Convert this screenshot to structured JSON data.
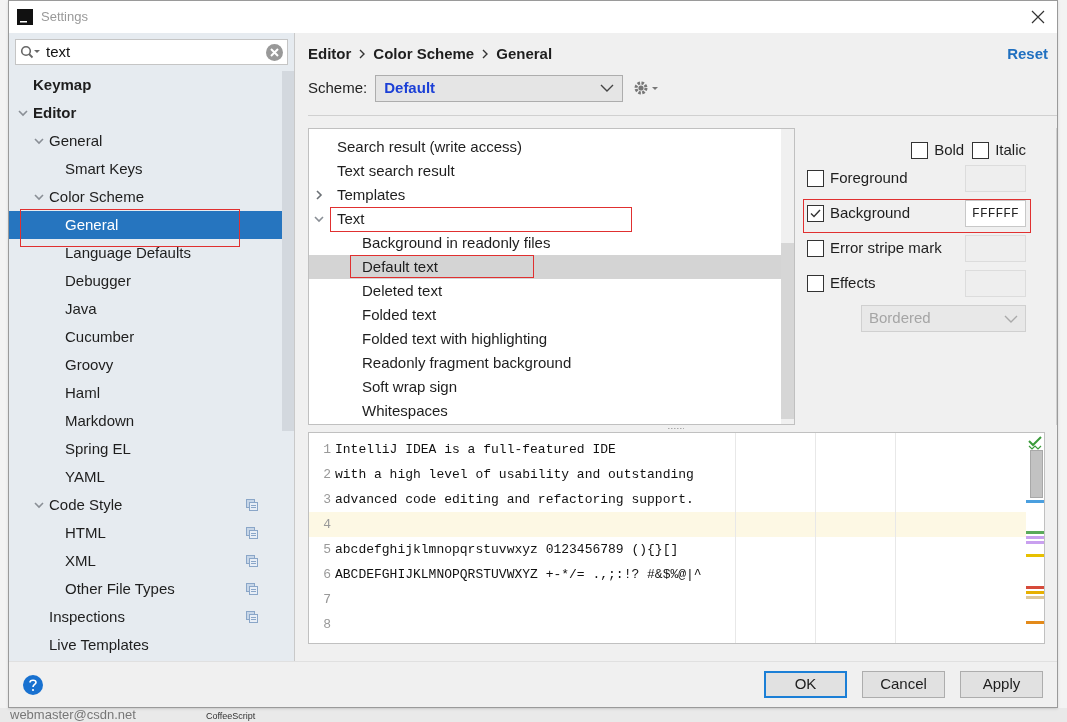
{
  "window": {
    "title": "Settings"
  },
  "background": {
    "texts": [
      "webmaster@csdn.net",
      "CoffeeScript"
    ]
  },
  "search": {
    "value": "text"
  },
  "sidebar": {
    "items": [
      {
        "label": "Keymap"
      },
      {
        "label": "Editor",
        "expanded": true,
        "children": [
          {
            "label": "General",
            "expanded": true,
            "children": [
              {
                "label": "Smart Keys",
                "selected": false
              }
            ]
          },
          {
            "label": "Color Scheme",
            "expanded": true,
            "children": [
              {
                "label": "General",
                "selected": true
              },
              {
                "label": "Language Defaults",
                "selected": false
              },
              {
                "label": "Debugger",
                "selected": false
              },
              {
                "label": "Java",
                "selected": false
              },
              {
                "label": "Cucumber",
                "selected": false
              },
              {
                "label": "Groovy",
                "selected": false
              },
              {
                "label": "Haml",
                "selected": false
              },
              {
                "label": "Markdown",
                "selected": false
              },
              {
                "label": "Spring EL",
                "selected": false
              },
              {
                "label": "YAML",
                "selected": false
              }
            ]
          },
          {
            "label": "Code Style",
            "expanded": true,
            "project_scope": true,
            "children": [
              {
                "label": "HTML",
                "project_scope": true
              },
              {
                "label": "XML",
                "project_scope": true
              },
              {
                "label": "Other File Types",
                "project_scope": true
              }
            ]
          },
          {
            "label": "Inspections",
            "project_scope": true
          },
          {
            "label": "Live Templates"
          }
        ]
      }
    ]
  },
  "breadcrumb": [
    "Editor",
    "Color Scheme",
    "General"
  ],
  "reset": "Reset",
  "scheme": {
    "label": "Scheme:",
    "value": "Default"
  },
  "attributes": [
    {
      "label": "Search result (write access)",
      "selected": false
    },
    {
      "label": "Text search result",
      "selected": false
    },
    {
      "label": "Templates",
      "expanded": false,
      "selected": false
    },
    {
      "label": "Text",
      "expanded": true,
      "selected": false,
      "children": [
        {
          "label": "Background in readonly files",
          "selected": false
        },
        {
          "label": "Default text",
          "selected": true
        },
        {
          "label": "Deleted text",
          "selected": false
        },
        {
          "label": "Folded text",
          "selected": false
        },
        {
          "label": "Folded text with highlighting",
          "selected": false
        },
        {
          "label": "Readonly fragment background",
          "selected": false
        },
        {
          "label": "Soft wrap sign",
          "selected": false
        },
        {
          "label": "Whitespaces",
          "selected": false
        }
      ]
    }
  ],
  "font_style": [
    {
      "label": "Bold",
      "checked": false
    },
    {
      "label": "Italic",
      "checked": false
    }
  ],
  "colors": [
    {
      "label": "Foreground",
      "checked": false
    },
    {
      "label": "Background",
      "checked": true,
      "value": "FFFFFF"
    },
    {
      "label": "Error stripe mark",
      "checked": false
    },
    {
      "label": "Effects",
      "checked": false
    }
  ],
  "effect_type": {
    "value": "Bordered",
    "disabled": true
  },
  "preview": {
    "lines": [
      {
        "number": "1",
        "text": "IntelliJ IDEA is a full-featured IDE",
        "current": false
      },
      {
        "number": "2",
        "text": "with a high level of usability and outstanding",
        "current": false
      },
      {
        "number": "3",
        "text": "advanced code editing and refactoring support.",
        "current": false
      },
      {
        "number": "4",
        "current": true
      },
      {
        "number": "5",
        "text": "abcdefghijklmnopqrstuvwxyz 0123456789 (){}[]",
        "current": false
      },
      {
        "number": "6",
        "text": "ABCDEFGHIJKLMNOPQRSTUVWXYZ +-*/= .,;:!? #&$%@|^",
        "current": false
      },
      {
        "number": "7",
        "current": false
      },
      {
        "number": "8",
        "current": false
      }
    ]
  },
  "buttons": [
    {
      "label": "OK",
      "kind": "default"
    },
    {
      "label": "Cancel",
      "kind": "normal"
    },
    {
      "label": "Apply",
      "kind": "normal"
    }
  ]
}
